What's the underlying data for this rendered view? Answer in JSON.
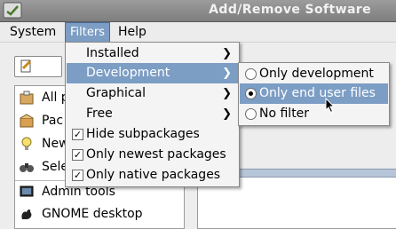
{
  "window": {
    "title": "Add/Remove Software"
  },
  "menubar": {
    "items": [
      {
        "label": "System"
      },
      {
        "label": "Filters"
      },
      {
        "label": "Help"
      }
    ]
  },
  "filters_menu": {
    "items": [
      {
        "label": "Installed",
        "submenu": true
      },
      {
        "label": "Development",
        "submenu": true,
        "active": true
      },
      {
        "label": "Graphical",
        "submenu": true
      },
      {
        "label": "Free",
        "submenu": true
      },
      {
        "label": "Hide subpackages",
        "checked": true
      },
      {
        "label": "Only newest packages",
        "checked": true
      },
      {
        "label": "Only native packages",
        "checked": true
      }
    ]
  },
  "development_submenu": {
    "items": [
      {
        "label": "Only development",
        "selected": false
      },
      {
        "label": "Only end user files",
        "selected": true
      },
      {
        "label": "No filter",
        "selected": false
      }
    ]
  },
  "categories": {
    "items": [
      {
        "label": "All p",
        "icon": "package-icon"
      },
      {
        "label": "Pac",
        "icon": "box-icon"
      },
      {
        "label": "New",
        "icon": "lightbulb-icon"
      },
      {
        "label": "Sele",
        "icon": "binoculars-icon"
      },
      {
        "label": "Admin tools",
        "icon": "admin-icon"
      },
      {
        "label": "GNOME desktop",
        "icon": "gnome-icon"
      }
    ]
  },
  "colors": {
    "highlight": "#7c9dc4",
    "titlebar": "#8a8a8a"
  }
}
